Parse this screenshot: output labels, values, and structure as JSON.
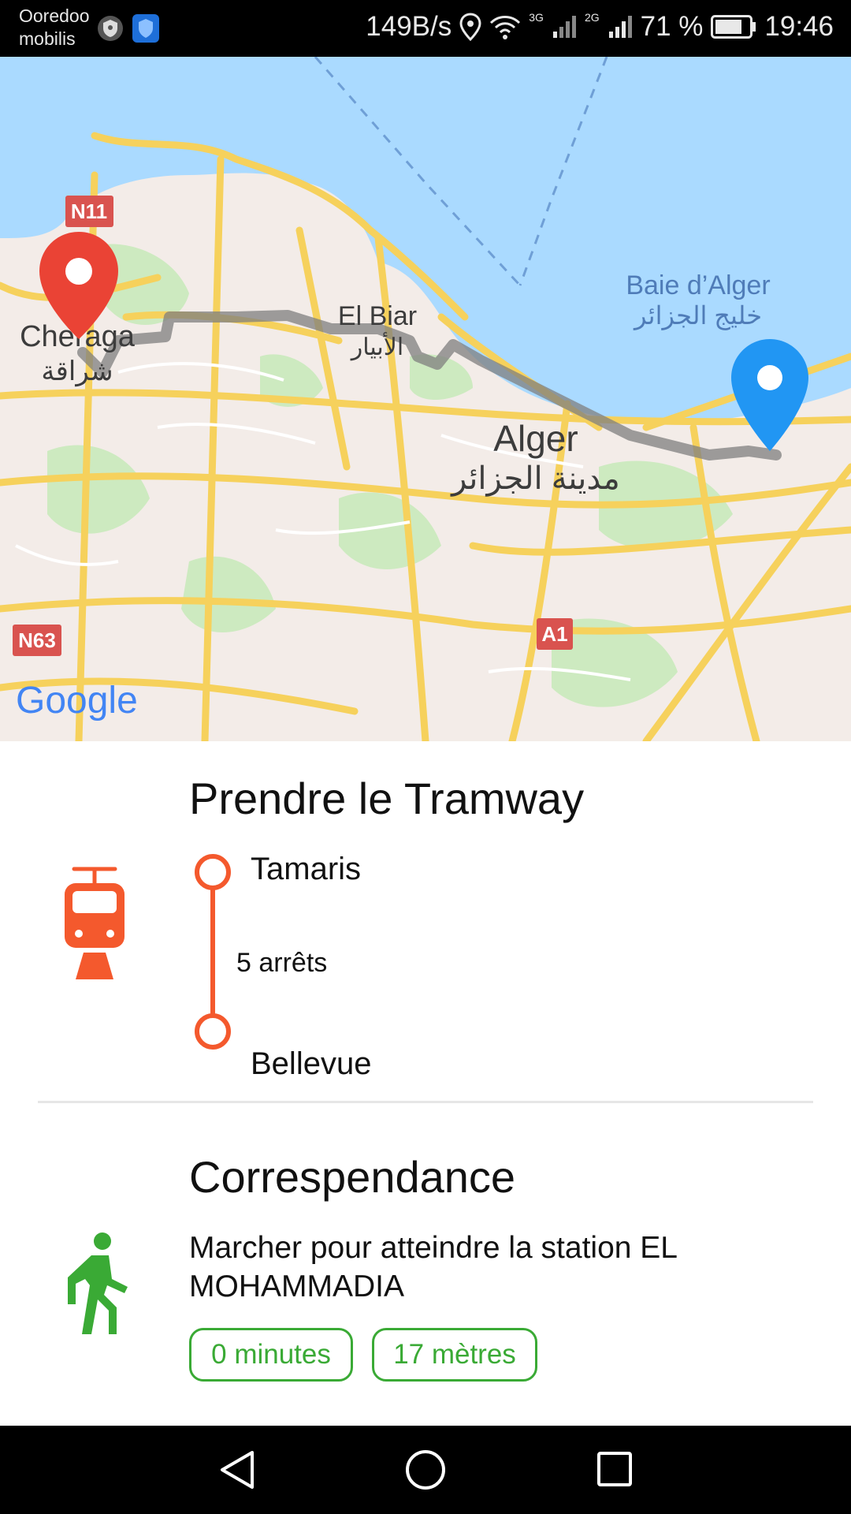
{
  "status_bar": {
    "carrier_1": "Ooredoo",
    "carrier_2": "mobilis",
    "net_speed": "149B/s",
    "sig1_label": "3G",
    "sig2_label": "2G",
    "battery": "71 %",
    "time": "19:46"
  },
  "map": {
    "labels": {
      "cheraga": "Cheraga",
      "cheraga_ar": "شراقة",
      "el_biar": "El Biar",
      "el_biar_ar": "الأبيار",
      "alger": "Alger",
      "alger_ar": "مدينة الجزائر",
      "baie": "Baie d’Alger",
      "baie_ar": "خليج الجزائر",
      "n11": "N11",
      "n63": "N63",
      "a1": "A1",
      "google": "Google"
    },
    "colors": {
      "water": "#aadaff",
      "land": "#f3ece8",
      "road": "#f6d15c",
      "origin_pin": "#ea4335",
      "destination_pin": "#2196f3",
      "route": "#7f7f7f"
    }
  },
  "steps": {
    "tram": {
      "title": "Prendre le Tramway",
      "from": "Tamaris",
      "stops": "5 arrêts",
      "to": "Bellevue",
      "icon": "tram-icon",
      "color": "#f4592d"
    },
    "transfer": {
      "title": "Correspendance",
      "description": "Marcher pour atteindre la station EL MOHAMMADIA",
      "duration": "0 minutes",
      "distance": "17 mètres",
      "icon": "walk-icon",
      "color": "#3aaa35"
    }
  },
  "nav": {
    "back": "back-icon",
    "home": "home-icon",
    "recents": "recents-icon"
  }
}
